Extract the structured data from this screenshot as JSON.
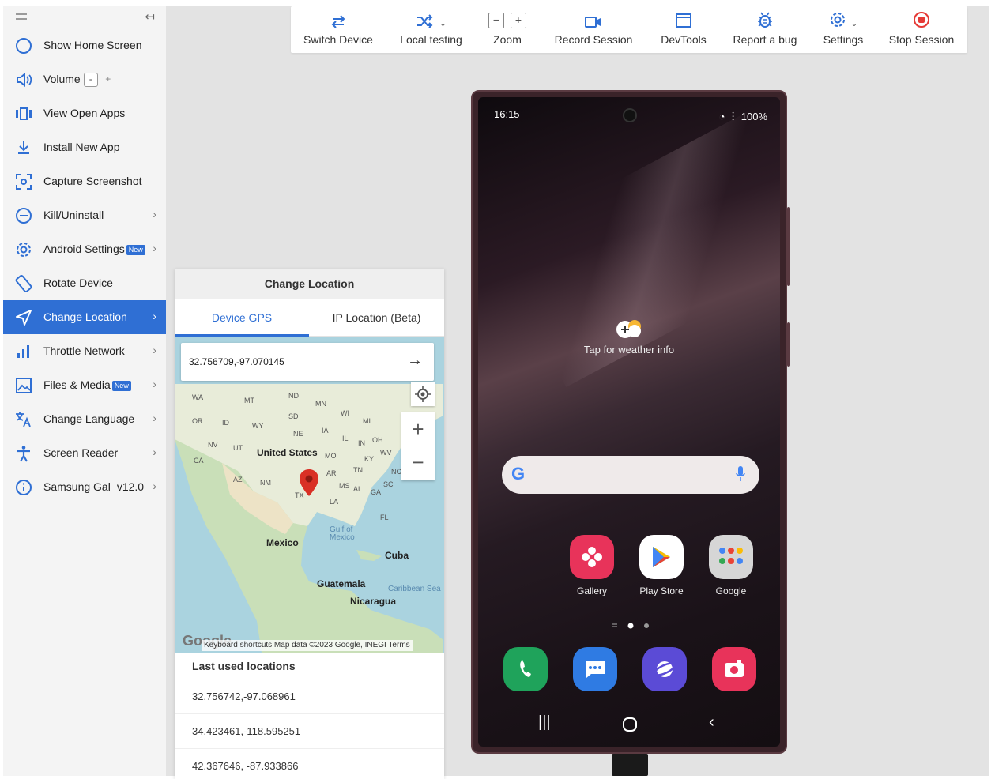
{
  "sidebar": {
    "items": [
      {
        "label": "Show Home Screen",
        "icon": "circle-icon"
      },
      {
        "label": "Volume",
        "icon": "speaker-icon",
        "minus": "-",
        "plus": "+"
      },
      {
        "label": "View Open Apps",
        "icon": "app-switcher-icon"
      },
      {
        "label": "Install New App",
        "icon": "download-icon"
      },
      {
        "label": "Capture Screenshot",
        "icon": "camera-frame-icon"
      },
      {
        "label": "Kill/Uninstall",
        "icon": "minus-circle-icon",
        "chevron": "›"
      },
      {
        "label": "Android Settings",
        "icon": "gear-icon",
        "badge": "New",
        "chevron": "›"
      },
      {
        "label": "Rotate Device",
        "icon": "rotate-icon"
      },
      {
        "label": "Change Location",
        "icon": "location-arrow-icon",
        "chevron": "›",
        "active": true
      },
      {
        "label": "Throttle Network",
        "icon": "signal-bars-icon",
        "chevron": "›"
      },
      {
        "label": "Files & Media",
        "icon": "image-icon",
        "badge": "New",
        "chevron": "›"
      },
      {
        "label": "Change Language",
        "icon": "translate-icon",
        "chevron": "›"
      },
      {
        "label": "Screen Reader",
        "icon": "accessibility-icon",
        "chevron": "›"
      },
      {
        "label": "Samsung Gal",
        "icon": "info-icon",
        "version": "v12.0",
        "chevron": "›"
      }
    ]
  },
  "toolbar": {
    "switch_device": "Switch Device",
    "local_testing": "Local testing",
    "zoom": "Zoom",
    "zoom_minus": "−",
    "zoom_plus": "+",
    "record_session": "Record Session",
    "devtools": "DevTools",
    "report_bug": "Report a bug",
    "settings": "Settings",
    "stop_session": "Stop Session"
  },
  "location_panel": {
    "title": "Change Location",
    "tabs": [
      "Device GPS",
      "IP Location (Beta)"
    ],
    "active_tab": "Device GPS",
    "coordinate_value": "32.756709,-97.070145",
    "map": {
      "country_label": "United States",
      "mexico_label": "Mexico",
      "cuba_label": "Cuba",
      "guatemala_label": "Guatemala",
      "nicaragua_label": "Nicaragua",
      "gulf_label": "Gulf of Mexico",
      "caribbean_label": "Caribbean Sea",
      "state_labels": [
        "WA",
        "MT",
        "ND",
        "MN",
        "OR",
        "ID",
        "SD",
        "WY",
        "WI",
        "MI",
        "NE",
        "IA",
        "NV",
        "UT",
        "IL",
        "IN",
        "OH",
        "CA",
        "MO",
        "KY",
        "WV",
        "AZ",
        "NM",
        "AR",
        "TN",
        "NC",
        "MS",
        "AL",
        "GA",
        "SC",
        "TX",
        "LA",
        "FL"
      ],
      "footer": "Keyboard shortcuts    Map data ©2023 Google, INEGI    Terms",
      "logo": "Google"
    },
    "last_used_title": "Last used locations",
    "last_used": [
      "32.756742,-97.068961",
      "34.423461,-118.595251",
      "42.367646, -87.933866"
    ]
  },
  "phone": {
    "time": "16:15",
    "battery": "100%",
    "weather_text": "Tap for weather info",
    "apps": [
      {
        "label": "Gallery",
        "color": "#e8335a"
      },
      {
        "label": "Play Store",
        "color": "#ffffff"
      },
      {
        "label": "Google",
        "color": "#d6d6d6"
      }
    ],
    "dock_colors": [
      "#1fa35b",
      "#2f7be3",
      "#5b4bd6",
      "#e8335a"
    ]
  },
  "colors": {
    "accent": "#2f6fd4",
    "stop": "#e53935"
  }
}
